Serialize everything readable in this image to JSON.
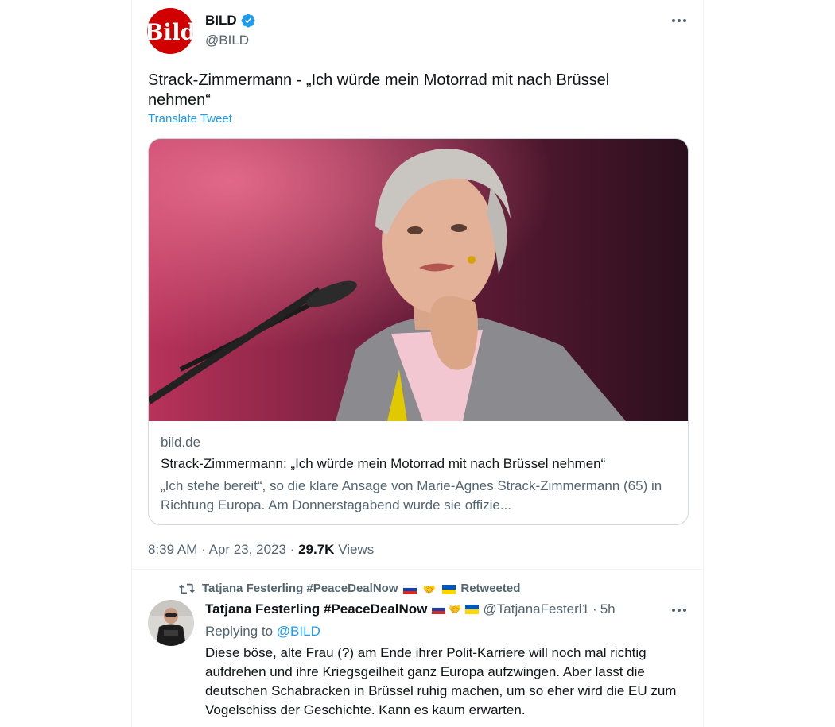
{
  "tweet": {
    "display_name": "BILD",
    "handle": "@BILD",
    "logo_text": "Bild",
    "text": "Strack-Zimmermann  - „Ich würde mein Motorrad mit nach Brüssel nehmen“",
    "translate_label": "Translate Tweet",
    "card": {
      "domain": "bild.de",
      "title": "Strack-Zimmermann: „Ich würde mein Motorrad mit nach Brüssel nehmen“",
      "description": "„Ich stehe bereit“, so die klare Ansage von Marie-Agnes Strack-Zimmermann (65) in Richtung Europa. Am Donnerstagabend wurde sie offizie..."
    },
    "time": "8:39 AM",
    "separator": "·",
    "date": "Apr 23, 2023",
    "views_count": "29.7K",
    "views_label": "Views"
  },
  "retweet_banner": {
    "name": "Tatjana Festerling #PeaceDealNow",
    "label": "Retweeted"
  },
  "reply": {
    "display_name": "Tatjana Festerling #PeaceDealNow",
    "handle": "@TatjanaFesterl1",
    "separator": "·",
    "time": "5h",
    "replying_prefix": "Replying to",
    "replying_to": "@BILD",
    "text": "Diese böse, alte Frau (?) am Ende ihrer Polit-Karriere will noch mal richtig aufdrehen und ihre Kriegsgeilheit ganz Europa aufzwingen. Aber lasst die deutschen Schabracken in Brüssel ruhig machen, um so eher wird die EU zum Vogelschiss der Geschichte. Kann es kaum erwarten."
  },
  "colors": {
    "accent": "#1d9bf0",
    "bild_red": "#d00000",
    "secondary_text": "#536471",
    "border": "#cfd9de"
  },
  "icons": [
    "verified-badge-icon",
    "more-options-icon",
    "retweet-icon",
    "russia-flag-icon",
    "handshake-icon",
    "ukraine-flag-icon"
  ]
}
